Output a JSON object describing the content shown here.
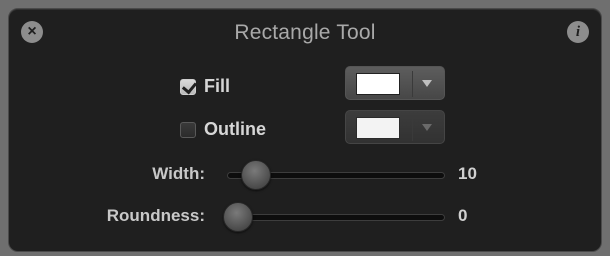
{
  "window": {
    "title": "Rectangle Tool",
    "close_icon": "close-icon",
    "info_icon": "info-icon",
    "close_glyph": "×",
    "info_glyph": "i"
  },
  "fill": {
    "label": "Fill",
    "checked": true,
    "color": "#ffffff"
  },
  "outline": {
    "label": "Outline",
    "checked": false,
    "color": "#ffffff"
  },
  "width": {
    "label": "Width:",
    "value": "10"
  },
  "roundness": {
    "label": "Roundness:",
    "value": "0"
  }
}
